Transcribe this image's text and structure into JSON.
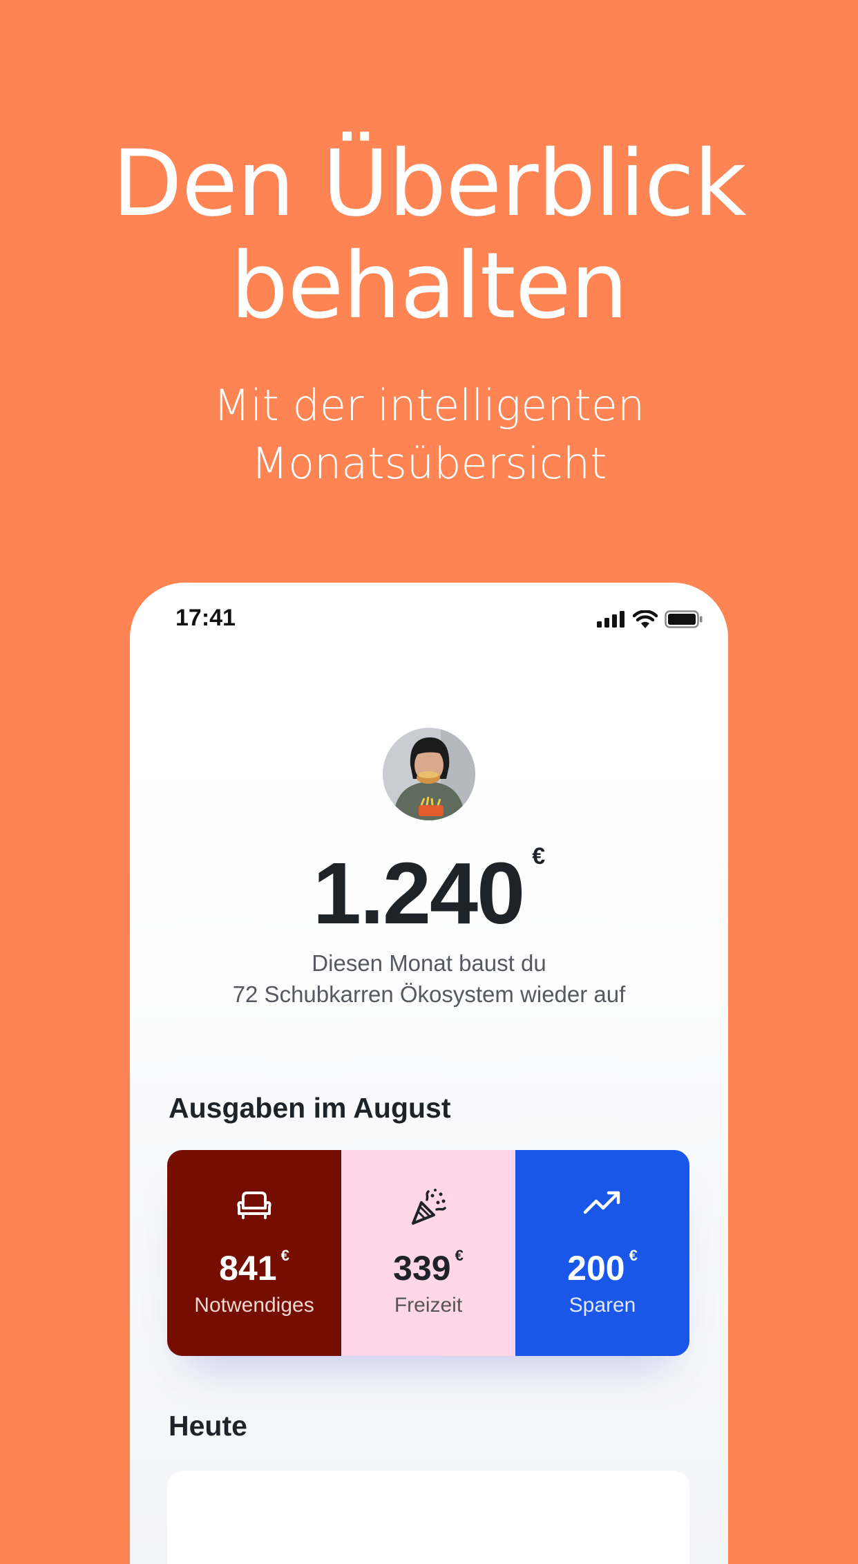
{
  "hero": {
    "title_line1": "Den Überblick",
    "title_line2": "behalten",
    "subtitle_line1": "Mit der intelligenten",
    "subtitle_line2": "Monatsübersicht"
  },
  "phone": {
    "status": {
      "time": "17:41"
    },
    "balance": {
      "amount": "1.240",
      "currency": "€"
    },
    "impact": {
      "line1": "Diesen Monat baust du",
      "line2": "72 Schubkarren Ökosystem wieder auf"
    },
    "spending": {
      "title": "Ausgaben im August",
      "categories": [
        {
          "icon": "sofa-icon",
          "amount": "841",
          "currency": "€",
          "label": "Notwendiges",
          "color": "#750E00"
        },
        {
          "icon": "party-popper-icon",
          "amount": "339",
          "currency": "€",
          "label": "Freizeit",
          "color": "#FFD7E7"
        },
        {
          "icon": "trend-up-icon",
          "amount": "200",
          "currency": "€",
          "label": "Sparen",
          "color": "#1A56E8"
        }
      ]
    },
    "today": {
      "title": "Heute"
    }
  },
  "colors": {
    "background": "#FF8454",
    "text_dark": "#1e2329"
  }
}
